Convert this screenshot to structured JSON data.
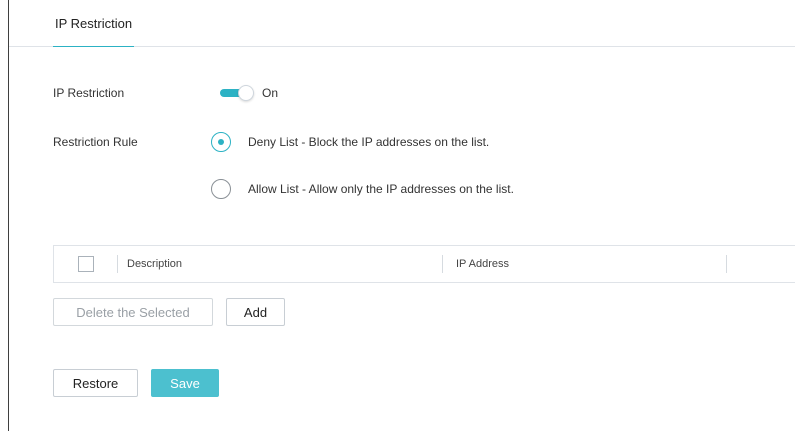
{
  "tabs": [
    {
      "label": "IP Restriction",
      "active": true
    }
  ],
  "ip_restriction": {
    "label": "IP Restriction",
    "toggle_state": "On",
    "enabled": true
  },
  "restriction_rule": {
    "label": "Restriction Rule",
    "options": [
      {
        "label": "Deny List - Block the IP addresses on the list.",
        "selected": true
      },
      {
        "label": "Allow List - Allow only the IP addresses on the list.",
        "selected": false
      }
    ]
  },
  "table": {
    "columns": [
      "Description",
      "IP Address"
    ],
    "rows": []
  },
  "buttons": {
    "delete_selected": "Delete the Selected",
    "add": "Add",
    "restore": "Restore",
    "save": "Save"
  },
  "colors": {
    "accent": "#2cb2c4",
    "save_button": "#4cc0cf",
    "border": "#dfe3e8"
  }
}
